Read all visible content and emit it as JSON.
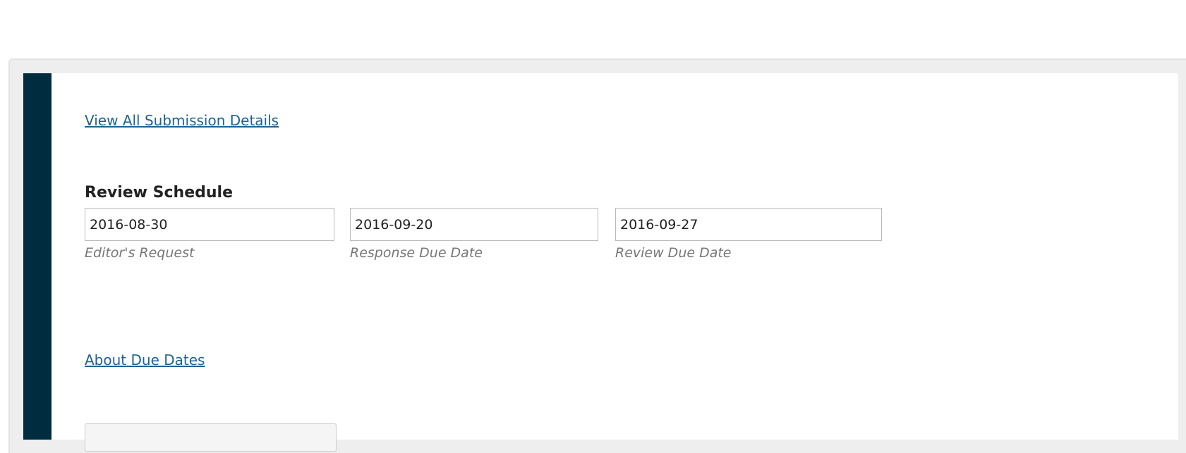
{
  "links": {
    "view_all_submission_details": "View All Submission Details",
    "about_due_dates": "About Due Dates"
  },
  "review_schedule": {
    "title": "Review Schedule",
    "fields": [
      {
        "value": "2016-08-30",
        "label": "Editor's Request"
      },
      {
        "value": "2016-09-20",
        "label": "Response Due Date"
      },
      {
        "value": "2016-09-27",
        "label": "Review Due Date"
      }
    ]
  },
  "colors": {
    "sidebar": "#002c40",
    "link": "#1e6292",
    "panel_bg": "#eeeeee"
  }
}
